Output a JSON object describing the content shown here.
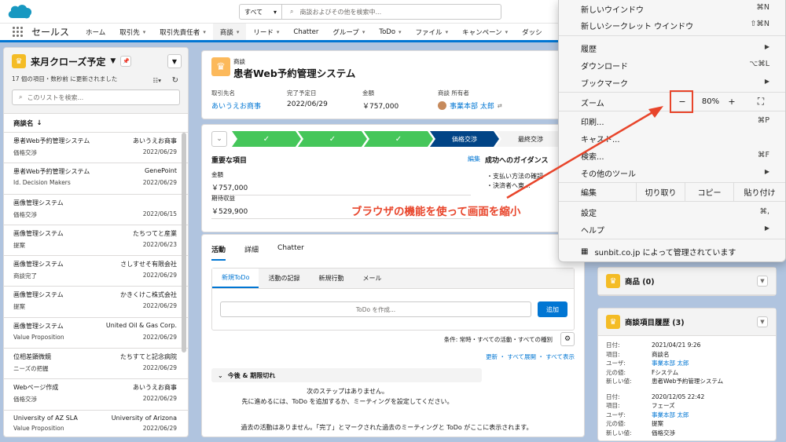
{
  "header": {
    "search_scope": "すべて",
    "search_placeholder": "商談およびその他を検索中..."
  },
  "nav": {
    "app_name": "セールス",
    "items": [
      "ホーム",
      "取引先",
      "取引先責任者",
      "商談",
      "リード",
      "Chatter",
      "グループ",
      "ToDo",
      "ファイル",
      "キャンペーン",
      "ダッシ"
    ]
  },
  "list": {
    "title": "来月クローズ予定",
    "subtitle": "17 個の項目・数秒前 に更新されました",
    "search_placeholder": "このリストを検索...",
    "column": "商談名",
    "rows": [
      {
        "name": "患者Web予約管理システム",
        "account": "あいうえお商事",
        "stage": "価格交渉",
        "date": "2022/06/29"
      },
      {
        "name": "患者Web予約管理システム",
        "account": "GenePoint",
        "stage": "Id. Decision Makers",
        "date": "2022/06/29"
      },
      {
        "name": "画像管理システム",
        "account": "",
        "stage": "価格交渉",
        "date": "2022/06/15"
      },
      {
        "name": "画像管理システム",
        "account": "たちつてと産業",
        "stage": "提案",
        "date": "2022/06/23"
      },
      {
        "name": "画像管理システム",
        "account": "さしすせそ有限会社",
        "stage": "商談完了",
        "date": "2022/06/29"
      },
      {
        "name": "画像管理システム",
        "account": "かきくけこ株式会社",
        "stage": "提案",
        "date": "2022/06/29"
      },
      {
        "name": "画像管理システム",
        "account": "United Oil & Gas Corp.",
        "stage": "Value Proposition",
        "date": "2022/06/29"
      },
      {
        "name": "位相差顕微鏡",
        "account": "たちすてと記念病院",
        "stage": "ニーズの把握",
        "date": "2022/06/29"
      },
      {
        "name": "Webページ作成",
        "account": "あいうえお商事",
        "stage": "価格交渉",
        "date": "2022/06/29"
      },
      {
        "name": "University of AZ SLA",
        "account": "University of Arizona",
        "stage": "Value Proposition",
        "date": "2022/06/29"
      }
    ]
  },
  "record": {
    "object": "商談",
    "name": "患者Web予約管理システム",
    "fields": [
      {
        "label": "取引先名",
        "value": "あいうえお商事",
        "link": true
      },
      {
        "label": "完了予定日",
        "value": "2022/06/29",
        "link": false
      },
      {
        "label": "金額",
        "value": "￥757,000",
        "link": false
      },
      {
        "label": "商談 所有者",
        "value": "事業本部 太郎",
        "link": true
      }
    ]
  },
  "path": {
    "current": "価格交渉",
    "next": "最終交渉",
    "key_fields_title": "重要な項目",
    "edit": "編集",
    "guidance_title": "成功へのガイダンス",
    "key_fields": [
      {
        "label": "金額",
        "value": "￥757,000"
      },
      {
        "label": "期待収益",
        "value": "￥529,900"
      }
    ],
    "guidance": [
      "・支払い方法の確認",
      "・決済者へ東..."
    ]
  },
  "activity": {
    "tabs": [
      "活動",
      "詳細",
      "Chatter"
    ],
    "subtabs": [
      "新規ToDo",
      "活動の記録",
      "新規行動",
      "メール"
    ],
    "todo_placeholder": "ToDo を作成...",
    "add": "追加",
    "filter": "条件: 常時・すべての活動・すべての種別",
    "links": "更新 ・ すべて展開 ・ すべて表示",
    "section": "今後 & 期限切れ",
    "no_steps": "次のステップはありません。",
    "no_steps_hint": "先に進めるには、ToDo を追加するか、ミーティングを設定してください。",
    "no_past": "過去の活動はありません。「完了」とマークされた過去のミーティングと ToDo がここに表示されます。"
  },
  "related": {
    "products": "商品 (0)",
    "history_title": "商談項目履歴 (3)",
    "history": [
      {
        "date": "2021/04/21 9:26",
        "field": "商談名",
        "user": "事業本部 太郎",
        "old": "Fシステム",
        "new": "患者Web予約管理システム"
      },
      {
        "date": "2020/12/05 22:42",
        "field": "フェーズ",
        "user": "事業本部 太郎",
        "old": "提案",
        "new": "価格交渉"
      }
    ],
    "labels": {
      "date": "日付:",
      "field": "項目:",
      "user": "ユーザ:",
      "old": "元の値:",
      "new": "新しい値:"
    }
  },
  "menu": {
    "new_window": "新しいウインドウ",
    "new_window_sc": "⌘N",
    "incognito": "新しいシークレット ウインドウ",
    "incognito_sc": "⇧⌘N",
    "history": "履歴",
    "downloads": "ダウンロード",
    "downloads_sc": "⌥⌘L",
    "bookmarks": "ブックマーク",
    "zoom": "ズーム",
    "zoom_minus": "−",
    "zoom_value": "80%",
    "zoom_plus": "+",
    "print": "印刷...",
    "print_sc": "⌘P",
    "cast": "キャスト...",
    "find": "検索...",
    "find_sc": "⌘F",
    "more_tools": "その他のツール",
    "edit": "編集",
    "cut": "切り取り",
    "copy": "コピー",
    "paste": "貼り付け",
    "settings": "設定",
    "settings_sc": "⌘,",
    "help": "ヘルプ",
    "managed": "sunbit.co.jp によって管理されています"
  },
  "annotation": "ブラウザの機能を使って画面を縮小",
  "colors": {
    "accent": "#0176d3",
    "annotation": "#e8452b",
    "path_done": "#45c65a",
    "path_current": "#014486"
  }
}
